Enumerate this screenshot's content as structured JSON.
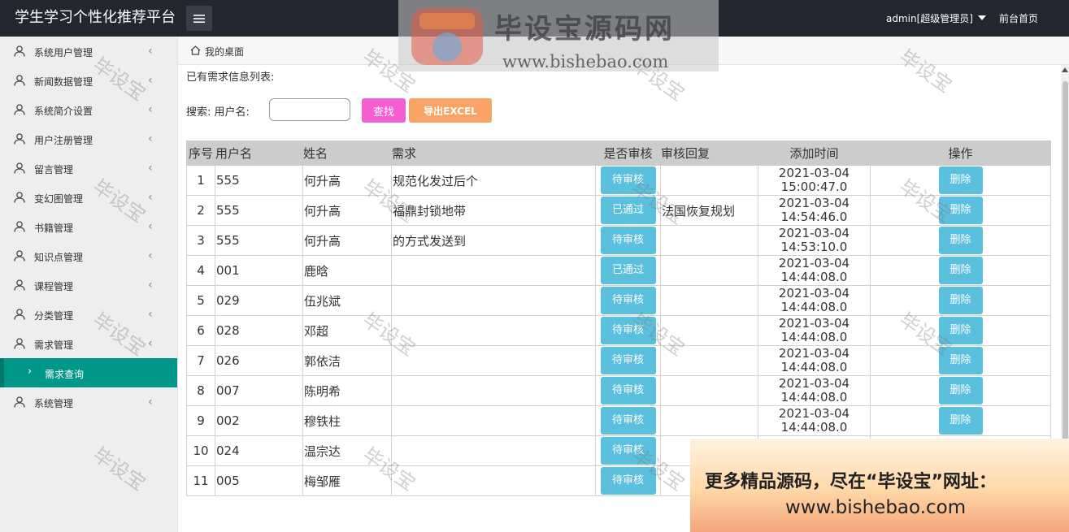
{
  "header": {
    "app_title": "学生学习个性化推荐平台",
    "admin_user": "admin[超级管理员]",
    "frontpage_link": "前台首页"
  },
  "sidebar": {
    "items": [
      {
        "label": "系统用户管理"
      },
      {
        "label": "新闻数据管理"
      },
      {
        "label": "系统简介设置"
      },
      {
        "label": "用户注册管理"
      },
      {
        "label": "留言管理"
      },
      {
        "label": "变幻图管理"
      },
      {
        "label": "书籍管理"
      },
      {
        "label": "知识点管理"
      },
      {
        "label": "课程管理"
      },
      {
        "label": "分类管理"
      },
      {
        "label": "需求管理"
      }
    ],
    "active_sub_item": "需求查询",
    "last_item": "系统管理"
  },
  "breadcrumb": {
    "current": "我的桌面"
  },
  "main": {
    "list_title": "已有需求信息列表:",
    "search_label": "搜索: 用户名:",
    "search_value": "",
    "search_button": "查找",
    "export_button": "导出EXCEL"
  },
  "table": {
    "headers": [
      "序号",
      "用户名",
      "姓名",
      "需求",
      "是否审核",
      "审核回复",
      "添加时间",
      "操作"
    ],
    "rows": [
      {
        "idx": "1",
        "user": "555",
        "name": "何升高",
        "demand": "规范化发过后个",
        "status": "待审核",
        "reply": "",
        "date": "2021-03-04",
        "time": "15:00:47.0",
        "op": "删除"
      },
      {
        "idx": "2",
        "user": "555",
        "name": "何升高",
        "demand": "福鼎封锁地带",
        "status": "已通过",
        "reply": "法国恢复规划",
        "date": "2021-03-04",
        "time": "14:54:46.0",
        "op": "删除"
      },
      {
        "idx": "3",
        "user": "555",
        "name": "何升高",
        "demand": "的方式发送到",
        "status": "待审核",
        "reply": "",
        "date": "2021-03-04",
        "time": "14:53:10.0",
        "op": "删除"
      },
      {
        "idx": "4",
        "user": "001",
        "name": "鹿晗",
        "demand": "",
        "status": "已通过",
        "reply": "",
        "date": "2021-03-04",
        "time": "14:44:08.0",
        "op": "删除"
      },
      {
        "idx": "5",
        "user": "029",
        "name": "伍兆斌",
        "demand": "",
        "status": "待审核",
        "reply": "",
        "date": "2021-03-04",
        "time": "14:44:08.0",
        "op": "删除"
      },
      {
        "idx": "6",
        "user": "028",
        "name": "邓超",
        "demand": "",
        "status": "待审核",
        "reply": "",
        "date": "2021-03-04",
        "time": "14:44:08.0",
        "op": "删除"
      },
      {
        "idx": "7",
        "user": "026",
        "name": "郭依洁",
        "demand": "",
        "status": "待审核",
        "reply": "",
        "date": "2021-03-04",
        "time": "14:44:08.0",
        "op": "删除"
      },
      {
        "idx": "8",
        "user": "007",
        "name": "陈明希",
        "demand": "",
        "status": "待审核",
        "reply": "",
        "date": "2021-03-04",
        "time": "14:44:08.0",
        "op": "删除"
      },
      {
        "idx": "9",
        "user": "002",
        "name": "穆铁柱",
        "demand": "",
        "status": "待审核",
        "reply": "",
        "date": "2021-03-04",
        "time": "14:44:08.0",
        "op": "删除"
      },
      {
        "idx": "10",
        "user": "024",
        "name": "温宗达",
        "demand": "",
        "status": "待审核",
        "reply": "",
        "date": "",
        "time": "",
        "op": ""
      },
      {
        "idx": "11",
        "user": "005",
        "name": "梅邹雁",
        "demand": "",
        "status": "待审核",
        "reply": "",
        "date": "",
        "time": "",
        "op": ""
      }
    ]
  },
  "watermark": {
    "text": "毕设宝",
    "logo_text": "毕设宝源码网",
    "logo_url": "www.bishebao.com",
    "promo_line1": "更多精品源码，尽在“毕设宝”网址：",
    "promo_line2": "www.bishebao.com"
  },
  "colors": {
    "topbar": "#23262e",
    "active_nav": "#009688",
    "search_button": "#f55fd2",
    "export_button": "#f9a365",
    "status_badge": "#5bc0de"
  }
}
